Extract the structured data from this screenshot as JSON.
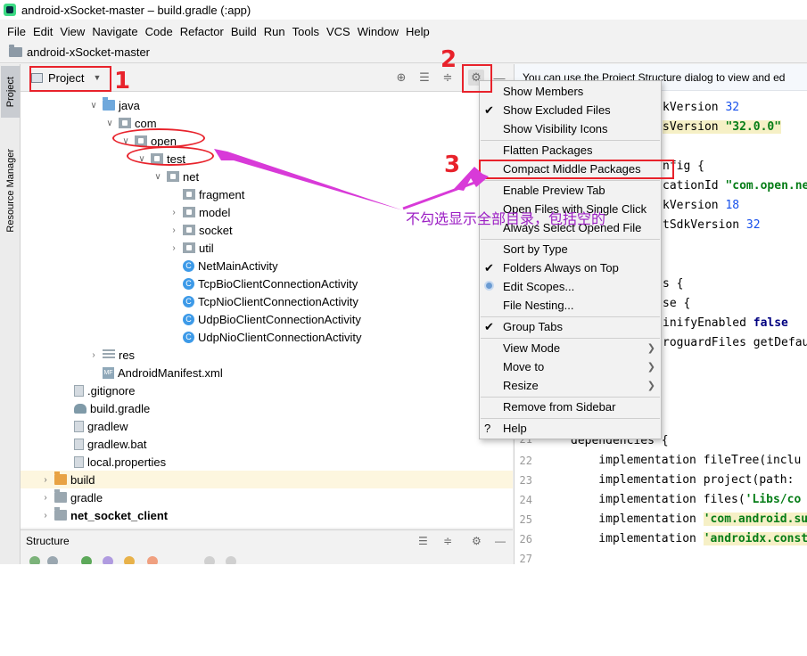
{
  "window": {
    "title": "android-xSocket-master – build.gradle (:app)"
  },
  "menu": [
    "File",
    "Edit",
    "View",
    "Navigate",
    "Code",
    "Refactor",
    "Build",
    "Run",
    "Tools",
    "VCS",
    "Window",
    "Help"
  ],
  "breadcrumb": {
    "project": "android-xSocket-master"
  },
  "side_tabs": {
    "project": "Project",
    "resource_manager": "Resource Manager"
  },
  "project_panel": {
    "view_mode": "Project",
    "tree": [
      {
        "label": "java",
        "icon": "folder-blue",
        "expand": "open"
      },
      {
        "label": "com",
        "icon": "package",
        "expand": "open"
      },
      {
        "label": "open",
        "icon": "package",
        "expand": "open"
      },
      {
        "label": "test",
        "icon": "package",
        "expand": "open"
      },
      {
        "label": "net",
        "icon": "package",
        "expand": "open"
      },
      {
        "label": "fragment",
        "icon": "package",
        "expand": "none"
      },
      {
        "label": "model",
        "icon": "package",
        "expand": "closed"
      },
      {
        "label": "socket",
        "icon": "package",
        "expand": "closed"
      },
      {
        "label": "util",
        "icon": "package",
        "expand": "closed"
      },
      {
        "label": "NetMainActivity",
        "icon": "class"
      },
      {
        "label": "TcpBioClientConnectionActivity",
        "icon": "class"
      },
      {
        "label": "TcpNioClientConnectionActivity",
        "icon": "class"
      },
      {
        "label": "UdpBioClientConnectionActivity",
        "icon": "class"
      },
      {
        "label": "UdpNioClientConnectionActivity",
        "icon": "class"
      },
      {
        "label": "res",
        "icon": "res-folder",
        "expand": "closed"
      },
      {
        "label": "AndroidManifest.xml",
        "icon": "manifest"
      },
      {
        "label": ".gitignore",
        "icon": "file"
      },
      {
        "label": "build.gradle",
        "icon": "gradle"
      },
      {
        "label": "gradlew",
        "icon": "file"
      },
      {
        "label": "gradlew.bat",
        "icon": "file"
      },
      {
        "label": "local.properties",
        "icon": "file"
      },
      {
        "label": "build",
        "icon": "folder-orange",
        "expand": "closed"
      },
      {
        "label": "gradle",
        "icon": "folder",
        "expand": "closed"
      },
      {
        "label": "net_socket_client",
        "icon": "module",
        "expand": "closed"
      }
    ]
  },
  "structure_panel": {
    "title": "Structure"
  },
  "popup_menu": {
    "items": [
      {
        "label": "Show Members",
        "state": "none"
      },
      {
        "label": "Show Excluded Files",
        "state": "checked"
      },
      {
        "label": "Show Visibility Icons",
        "state": "none"
      },
      {
        "label": "Flatten Packages",
        "state": "none"
      },
      {
        "label": "Compact Middle Packages",
        "state": "none"
      },
      {
        "label": "Enable Preview Tab",
        "state": "none"
      },
      {
        "label": "Open Files with Single Click",
        "state": "none"
      },
      {
        "label": "Always Select Opened File",
        "state": "none"
      },
      {
        "label": "Sort by Type",
        "state": "none"
      },
      {
        "label": "Folders Always on Top",
        "state": "checked"
      },
      {
        "label": "Edit Scopes...",
        "state": "radio"
      },
      {
        "label": "File Nesting...",
        "state": "none"
      },
      {
        "label": "Group Tabs",
        "state": "checked"
      },
      {
        "label": "View Mode",
        "state": "submenu"
      },
      {
        "label": "Move to",
        "state": "submenu"
      },
      {
        "label": "Resize",
        "state": "submenu"
      },
      {
        "label": "Remove from Sidebar",
        "state": "none"
      },
      {
        "label": "Help",
        "state": "help"
      }
    ]
  },
  "editor": {
    "notice": "You can use the Project Structure dialog to view and ed",
    "lines": {
      "l1_prefix": "kVersion ",
      "l1_num": "32",
      "l2_prefix": "sVersion ",
      "l2_str": "\"32.0.0\"",
      "l3": "nfig {",
      "l4_prefix": "cationId ",
      "l4_str": "\"com.open.ne",
      "l5_prefix": "kVersion ",
      "l5_num": "18",
      "l6_prefix": "tSdkVersion ",
      "l6_num": "32",
      "l7": "s {",
      "l8": "se {",
      "l9_prefix": "inifyEnabled ",
      "l9_kw": "false",
      "l10": "roguardFiles getDefau",
      "l21": "dependencies {",
      "l22": "    implementation fileTree(inclu",
      "l23": "    implementation project(path: ",
      "l24_prefix": "    implementation files(",
      "l24_str": "'Libs/co",
      "l25_prefix": "    implementation ",
      "l25_str": "'com.android.su",
      "l26_prefix": "    implementation ",
      "l26_str": "'androidx.const"
    },
    "line_numbers": [
      "21",
      "22",
      "23",
      "24",
      "25",
      "26",
      "27"
    ]
  },
  "annotations": {
    "n1": "1",
    "n2": "2",
    "n3": "3",
    "note": "不勾选显示全部目录，包括空的"
  }
}
